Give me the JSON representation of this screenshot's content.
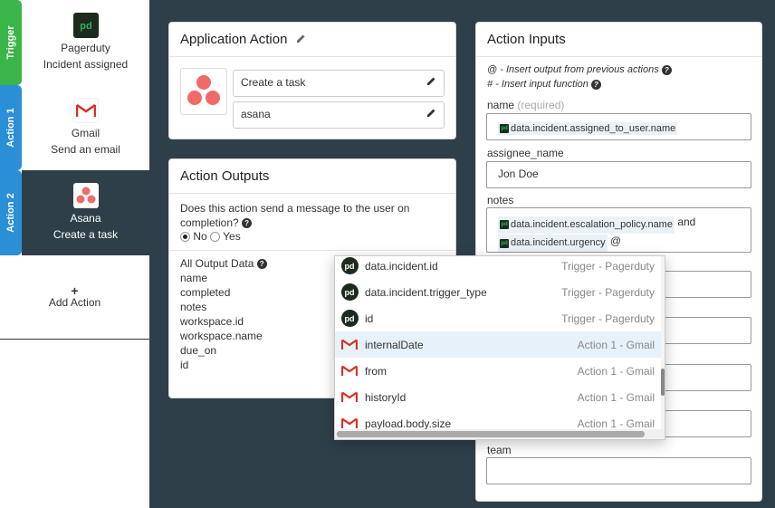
{
  "sidebar": {
    "steps": [
      {
        "tab": "Trigger",
        "title": "Pagerduty",
        "subtitle": "Incident assigned",
        "tab_color": "#3ab54a",
        "icon": "pagerduty-icon"
      },
      {
        "tab": "Action 1",
        "title": "Gmail",
        "subtitle": "Send an email",
        "tab_color": "#2a8fd6",
        "icon": "gmail-icon"
      },
      {
        "tab": "Action 2",
        "title": "Asana",
        "subtitle": "Create a task",
        "tab_color": "#2a8fd6",
        "icon": "asana-icon"
      }
    ],
    "add_action": {
      "plus": "+",
      "label": "Add Action"
    }
  },
  "application_action": {
    "title": "Application Action",
    "action_value": "Create a task",
    "app_value": "asana"
  },
  "action_outputs": {
    "title": "Action Outputs",
    "question": "Does this action send a message to the user on completion?",
    "options": [
      "No",
      "Yes"
    ],
    "selected": "No",
    "all_output_label": "All Output Data",
    "fields": [
      "name",
      "completed",
      "notes",
      "workspace.id",
      "workspace.name",
      "due_on",
      "id"
    ]
  },
  "action_inputs": {
    "title": "Action Inputs",
    "help1": "@ - Insert output from previous actions",
    "help2": "# - Insert input function",
    "name_label": "name",
    "name_required": "(required)",
    "name_token": "data.incident.assigned_to_user.name",
    "assignee_label": "assignee_name",
    "assignee_value": "Jon Doe",
    "notes_label": "notes",
    "notes_token1": "data.incident.escalation_policy.name",
    "notes_and": "and",
    "notes_token2": "data.incident.urgency",
    "notes_trailing": "@",
    "team_label": "team"
  },
  "dropdown": {
    "items": [
      {
        "name": "data.incident.id",
        "source": "Trigger - Pagerduty",
        "icon": "pagerduty-icon"
      },
      {
        "name": "data.incident.trigger_type",
        "source": "Trigger - Pagerduty",
        "icon": "pagerduty-icon"
      },
      {
        "name": "id",
        "source": "Trigger - Pagerduty",
        "icon": "pagerduty-icon"
      },
      {
        "name": "internalDate",
        "source": "Action 1 - Gmail",
        "icon": "gmail-icon",
        "highlighted": true
      },
      {
        "name": "from",
        "source": "Action 1 - Gmail",
        "icon": "gmail-icon"
      },
      {
        "name": "historyId",
        "source": "Action 1 - Gmail",
        "icon": "gmail-icon"
      },
      {
        "name": "payload.body.size",
        "source": "Action 1 - Gmail",
        "icon": "gmail-icon"
      }
    ]
  },
  "colors": {
    "background": "#2f3f4a",
    "trigger_tab": "#3ab54a",
    "action_tab": "#2a8fd6",
    "pagerduty_green": "#29b35d",
    "asana_red": "#f06a6a"
  }
}
